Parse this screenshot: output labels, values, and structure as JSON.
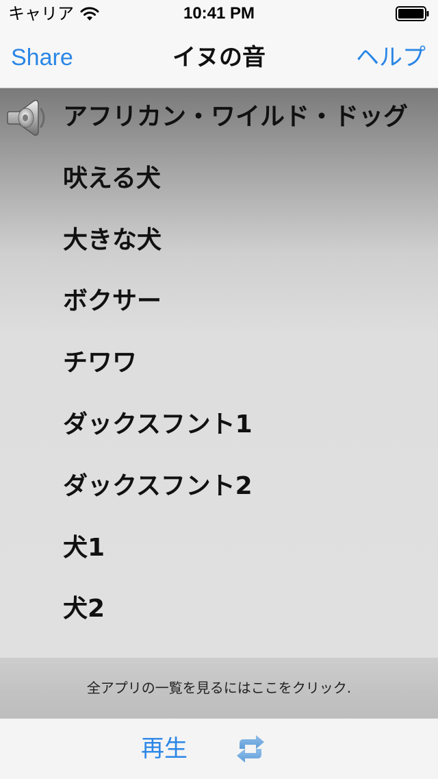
{
  "status_bar": {
    "carrier": "キャリア",
    "time": "10:41 PM",
    "icons": [
      "wifi-icon",
      "battery-icon"
    ]
  },
  "nav": {
    "left_label": "Share",
    "title": "イヌの音",
    "right_label": "ヘルプ"
  },
  "sounds": [
    "アフリカン・ワイルド・ドッグ",
    "吠える犬",
    "大きな犬",
    "ボクサー",
    "チワワ",
    "ダックスフント1",
    "ダックスフント2",
    "犬1",
    "犬2"
  ],
  "playing_index": 0,
  "banner": {
    "text": "全アプリの一覧を見るにはここをクリック."
  },
  "toolbar": {
    "play_label": "再生",
    "repeat_icon": "repeat-icon"
  },
  "colors": {
    "accent": "#2a86e6"
  }
}
